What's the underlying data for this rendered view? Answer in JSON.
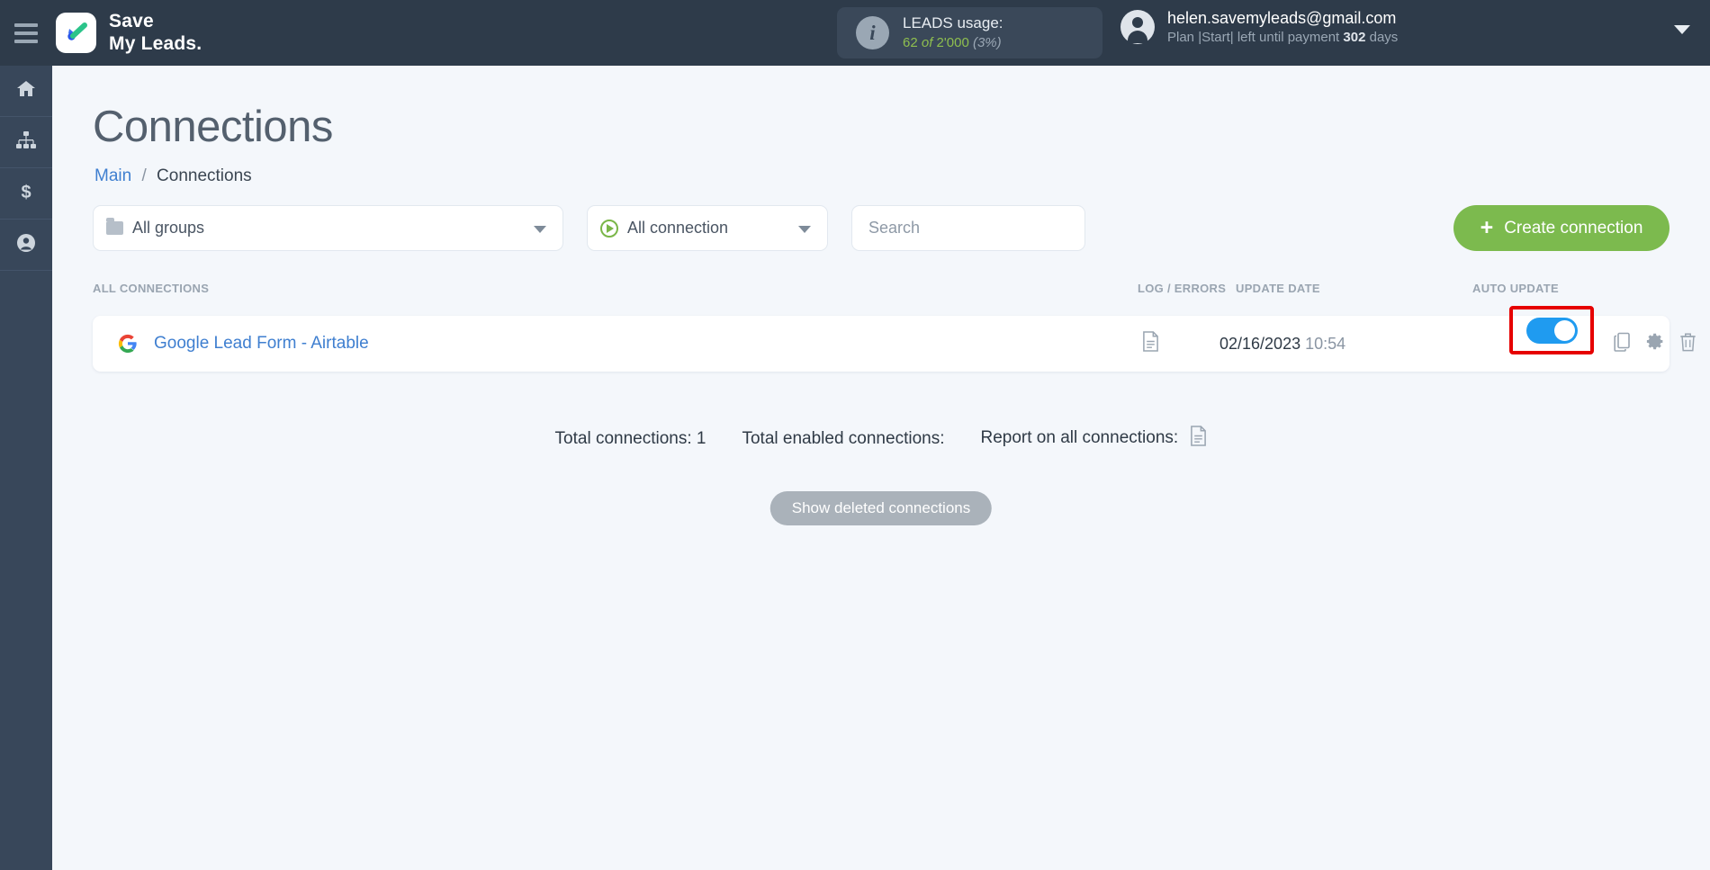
{
  "header": {
    "menu_icon": "hamburger-icon",
    "logo": {
      "line1": "Save",
      "line2": "My Leads."
    },
    "usage": {
      "info_icon": "info-icon",
      "title": "LEADS usage:",
      "used": "62",
      "of": "of",
      "total": "2'000",
      "percent": "(3%)"
    },
    "account": {
      "avatar_icon": "user-avatar-icon",
      "email": "helen.savemyleads@gmail.com",
      "plan_prefix": "Plan |Start| left until payment",
      "days_value": "302",
      "days_suffix": "days",
      "chevron_icon": "chevron-down-icon"
    }
  },
  "sidebar": {
    "items": [
      {
        "icon": "home-icon",
        "name": "sidebar-item-home"
      },
      {
        "icon": "sitemap-icon",
        "name": "sidebar-item-connections"
      },
      {
        "icon": "dollar-icon",
        "name": "sidebar-item-billing"
      },
      {
        "icon": "user-icon",
        "name": "sidebar-item-account"
      }
    ]
  },
  "page": {
    "title": "Connections",
    "breadcrumb": {
      "root": "Main",
      "separator": "/",
      "current": "Connections"
    }
  },
  "filters": {
    "groups": {
      "label": "All groups",
      "icon": "folder-icon",
      "chevron": "chevron-down-icon"
    },
    "connection": {
      "label": "All connection",
      "icon": "play-circle-icon",
      "chevron": "chevron-down-icon"
    },
    "search": {
      "placeholder": "Search",
      "value": ""
    },
    "create_button": {
      "label": "Create connection",
      "icon": "plus-icon",
      "color": "#7cba4e"
    }
  },
  "table": {
    "headers": {
      "all_connections": "ALL CONNECTIONS",
      "log_errors": "LOG / ERRORS",
      "update_date": "UPDATE DATE",
      "auto_update": "AUTO UPDATE"
    },
    "rows": [
      {
        "service_icon": "google-icon",
        "name": "Google Lead Form - Airtable",
        "log_icon": "document-icon",
        "date": "02/16/2023",
        "time": "10:54",
        "auto_update_on": true,
        "highlight_color": "#e60000",
        "actions": [
          "copy-icon",
          "gear-icon",
          "trash-icon"
        ]
      }
    ]
  },
  "footer": {
    "total_connections_label": "Total connections:",
    "total_connections_value": "1",
    "total_enabled_label": "Total enabled connections:",
    "total_enabled_value": "",
    "report_label": "Report on all connections:",
    "report_icon": "document-icon",
    "show_deleted_button": "Show deleted connections"
  }
}
